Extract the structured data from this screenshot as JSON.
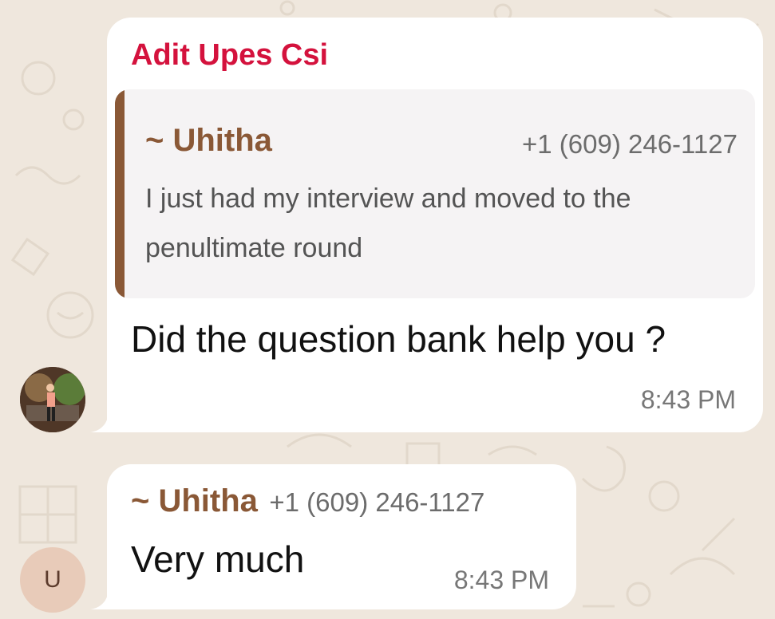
{
  "messages": [
    {
      "sender": "Adit Upes Csi",
      "quote": {
        "author": "~ Uhitha",
        "phone": "+1 (609) 246-1127",
        "text": "I just had my interview and moved to the penultimate round"
      },
      "text": "Did the question bank help you ?",
      "time": "8:43 PM"
    },
    {
      "author": "~ Uhitha",
      "phone": "+1 (609) 246-1127",
      "text": "Very much",
      "time": "8:43 PM",
      "avatar_initial": "U"
    }
  ],
  "colors": {
    "background": "#efe7dd",
    "sender_name": "#d4123d",
    "quote_accent": "#8a5836",
    "bubble": "#ffffff"
  },
  "icons": {
    "avatar_1": "profile-photo",
    "avatar_2": "initial-avatar"
  }
}
